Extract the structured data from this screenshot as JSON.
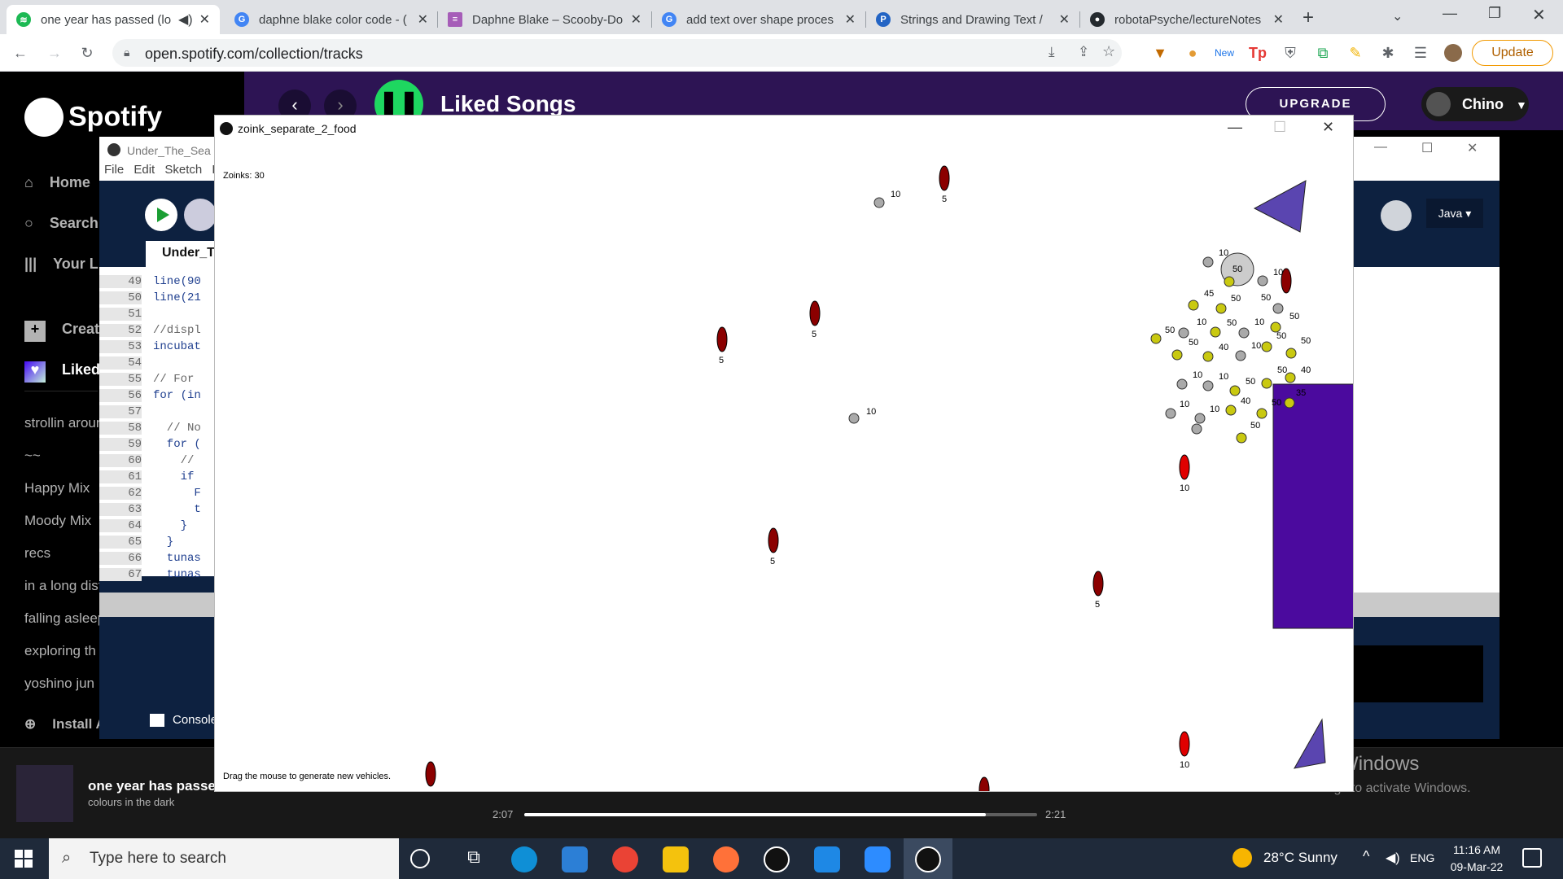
{
  "browser": {
    "tabs": [
      {
        "title": "one year has passed (lo",
        "active": true,
        "favicon_color": "#1db954"
      },
      {
        "title": "daphne blake color code - (",
        "favicon_color": "#4285f4"
      },
      {
        "title": "Daphne Blake – Scooby-Do",
        "favicon_color": "#a65db8"
      },
      {
        "title": "add text over shape proces",
        "favicon_color": "#4285f4"
      },
      {
        "title": "Strings and Drawing Text / ",
        "favicon_color": "#2364c4"
      },
      {
        "title": "robotaPsyche/lectureNotes",
        "favicon_color": "#24292e"
      }
    ],
    "url": "open.spotify.com/collection/tracks",
    "update_label": "Update"
  },
  "spotify": {
    "logo": "Spotify",
    "page_title": "Liked Songs",
    "upgrade_label": "UPGRADE",
    "user_name": "Chino",
    "nav": [
      "Home",
      "Search",
      "Your Library"
    ],
    "create_label": "Create Playlist",
    "liked_label": "Liked Songs",
    "playlists": [
      "strollin around",
      "~~",
      "Happy Mix",
      "Moody Mix",
      "recs",
      "in a long distance",
      "falling asleep",
      "exploring th",
      "yoshino jun"
    ],
    "install_label": "Install App",
    "now_playing": {
      "title": "one year has passed",
      "artist": "colours in the dark"
    },
    "time_current": "2:07",
    "time_total": "2:21",
    "progress": 0.9
  },
  "ide": {
    "window_title": "Under_The_Sea",
    "menu": [
      "File",
      "Edit",
      "Sketch",
      "De"
    ],
    "code_tab": "Under_T",
    "mode": "Java",
    "console_tab": "Console",
    "code_lines": [
      {
        "n": "49",
        "t": "line(90"
      },
      {
        "n": "50",
        "t": "line(21"
      },
      {
        "n": "51",
        "t": ""
      },
      {
        "n": "52",
        "t": "//displ"
      },
      {
        "n": "53",
        "t": "incubat"
      },
      {
        "n": "54",
        "t": ""
      },
      {
        "n": "55",
        "t": "// For"
      },
      {
        "n": "56",
        "t": "for (in"
      },
      {
        "n": "57",
        "t": ""
      },
      {
        "n": "58",
        "t": "  // No"
      },
      {
        "n": "59",
        "t": "  for ("
      },
      {
        "n": "60",
        "t": "    //"
      },
      {
        "n": "61",
        "t": "    if"
      },
      {
        "n": "62",
        "t": "      F"
      },
      {
        "n": "63",
        "t": "      t"
      },
      {
        "n": "64",
        "t": "    }"
      },
      {
        "n": "65",
        "t": "  }"
      },
      {
        "n": "66",
        "t": "  tunas"
      },
      {
        "n": "67",
        "t": "  tunas"
      }
    ]
  },
  "sketch": {
    "window_title": "zoink_separate_2_food",
    "score_label": "Zoinks: 30",
    "hint": "Drag the mouse to generate new vehicles."
  },
  "windows": {
    "activate_title": "Activate Windows",
    "activate_sub": "Go to Settings to activate Windows.",
    "search_placeholder": "Type here to search",
    "weather": "28°C  Sunny",
    "lang": "ENG",
    "time": "11:16 AM",
    "date": "09-Mar-22"
  }
}
